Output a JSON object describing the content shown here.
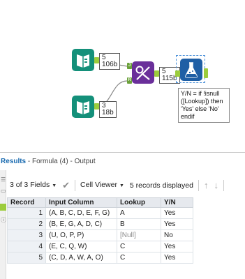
{
  "canvas": {
    "input1": {
      "record_count": "5",
      "size": "106b"
    },
    "input2": {
      "record_count": "3",
      "size": "18b"
    },
    "join": {
      "label_J": "J",
      "label_R": "R"
    },
    "formula": {
      "record_count": "5",
      "size": "115b"
    },
    "annotation": "Y/N = if !isnull ([Lookup]) then 'Yes' else 'No' endif"
  },
  "results": {
    "label": "Results",
    "path": " - Formula (4) - Output",
    "fields_label": "3 of 3 Fields",
    "cell_viewer_label": "Cell Viewer",
    "records_displayed": "5 records displayed"
  },
  "table": {
    "columns": [
      "Record",
      "Input Column",
      "Lookup",
      "Y/N"
    ],
    "rows": [
      {
        "record": "1",
        "input_column": "(A, B, C, D, E, F, G)",
        "lookup": "A",
        "yn": "Yes"
      },
      {
        "record": "2",
        "input_column": "(B, E, G, A, D, C)",
        "lookup": "B",
        "yn": "Yes"
      },
      {
        "record": "3",
        "input_column": "(U, O, P, P)",
        "lookup": "[Null]",
        "yn": "No"
      },
      {
        "record": "4",
        "input_column": "(E, C, Q, W)",
        "lookup": "C",
        "yn": "Yes"
      },
      {
        "record": "5",
        "input_column": "(C, D, A, W, A, O)",
        "lookup": "C",
        "yn": "Yes"
      }
    ]
  },
  "colors": {
    "input_tool": "#14907a",
    "join_tool": "#6a2f9a",
    "formula_tool": "#1f5fa5",
    "anchor": "#9ccc3c",
    "results_accent": "#1a6bb0"
  },
  "icons": {
    "input": "book-icon",
    "join": "join-icon",
    "formula": "flask-icon",
    "check": "check-icon",
    "up": "arrow-up-icon",
    "down": "arrow-down-icon"
  }
}
